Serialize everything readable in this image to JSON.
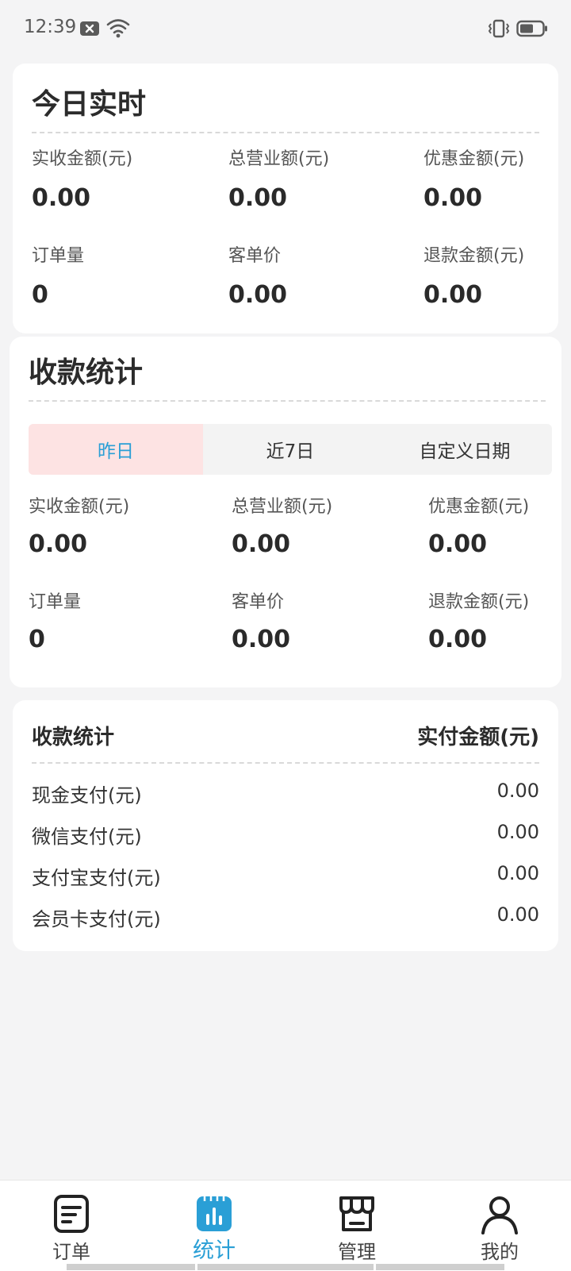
{
  "status_bar": {
    "time": "12:39"
  },
  "realtime": {
    "title": "今日实时",
    "stats": [
      {
        "label": "实收金额(元)",
        "value": "0.00"
      },
      {
        "label": "总营业额(元)",
        "value": "0.00"
      },
      {
        "label": "优惠金额(元)",
        "value": "0.00"
      },
      {
        "label": "订单量",
        "value": "0"
      },
      {
        "label": "客单价",
        "value": "0.00"
      },
      {
        "label": "退款金额(元)",
        "value": "0.00"
      }
    ]
  },
  "collection": {
    "title": "收款统计",
    "tabs": [
      {
        "label": "昨日",
        "active": true
      },
      {
        "label": "近7日",
        "active": false
      },
      {
        "label": "自定义日期",
        "active": false
      }
    ],
    "stats": [
      {
        "label": "实收金额(元)",
        "value": "0.00"
      },
      {
        "label": "总营业额(元)",
        "value": "0.00"
      },
      {
        "label": "优惠金额(元)",
        "value": "0.00"
      },
      {
        "label": "订单量",
        "value": "0"
      },
      {
        "label": "客单价",
        "value": "0.00"
      },
      {
        "label": "退款金额(元)",
        "value": "0.00"
      }
    ]
  },
  "payment": {
    "title": "收款统计",
    "amount_header": "实付金额(元)",
    "rows": [
      {
        "name": "现金支付(元)",
        "value": "0.00"
      },
      {
        "name": "微信支付(元)",
        "value": "0.00"
      },
      {
        "name": "支付宝支付(元)",
        "value": "0.00"
      },
      {
        "name": "会员卡支付(元)",
        "value": "0.00"
      }
    ]
  },
  "bottom_nav": {
    "items": [
      {
        "label": "订单",
        "icon": "order-icon",
        "active": false
      },
      {
        "label": "统计",
        "icon": "stats-icon",
        "active": true
      },
      {
        "label": "管理",
        "icon": "store-icon",
        "active": false
      },
      {
        "label": "我的",
        "icon": "user-icon",
        "active": false
      }
    ]
  },
  "colors": {
    "accent": "#2a9fd6",
    "active_tab_bg": "#fde3e3",
    "page_bg": "#f4f4f5"
  }
}
